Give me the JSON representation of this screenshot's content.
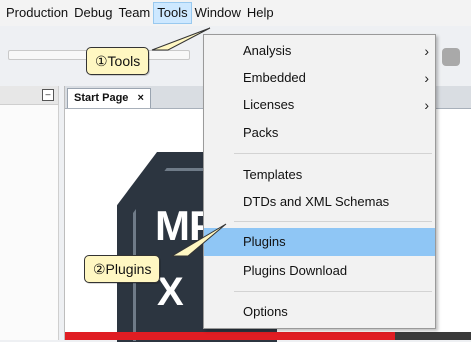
{
  "menubar": {
    "items": [
      {
        "label": "Production"
      },
      {
        "label": "Debug"
      },
      {
        "label": "Team"
      },
      {
        "label": "Tools"
      },
      {
        "label": "Window"
      },
      {
        "label": "Help"
      }
    ]
  },
  "editor": {
    "tab_label": "Start Page",
    "tab_close": "×",
    "logo_text": "MP",
    "logo_x": "X"
  },
  "leftpanel": {
    "minimize_glyph": "–"
  },
  "tools_menu": {
    "items": [
      {
        "label": "Analysis",
        "submenu": true
      },
      {
        "label": "Embedded",
        "submenu": true
      },
      {
        "label": "Licenses",
        "submenu": true
      },
      {
        "label": "Packs",
        "submenu": false
      },
      {
        "label": "Templates",
        "submenu": false
      },
      {
        "label": "DTDs and XML Schemas",
        "submenu": false
      },
      {
        "label": "Plugins",
        "submenu": false,
        "highlighted": true
      },
      {
        "label": "Plugins Download",
        "submenu": false
      },
      {
        "label": "Options",
        "submenu": false
      }
    ],
    "submenu_arrow": "›"
  },
  "callouts": {
    "tools": "①Tools",
    "plugins": "②Plugins"
  },
  "colors": {
    "highlight": "#8fc6f5",
    "callout_fill": "#fff7c2",
    "brand_red": "#e01d23"
  }
}
